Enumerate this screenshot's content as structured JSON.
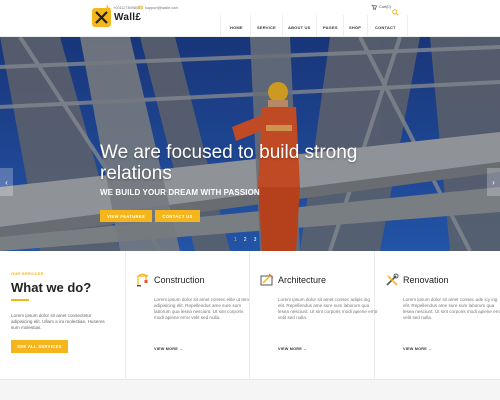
{
  "header": {
    "logo_text": "Wall£",
    "phone": "+0011278098081",
    "email": "support@walle.com",
    "cart": "Cart(0)",
    "nav": [
      "HOME",
      "SERVICE",
      "ABOUT US",
      "PAGES",
      "SHOP",
      "CONTACT"
    ]
  },
  "hero": {
    "title": "We are focused to build strong relations",
    "subtitle": "WE BUILD YOUR DREAM WITH PASSION",
    "primary_button": "VIEW FEATURES",
    "secondary_button": "CONTACT US",
    "slides": [
      "1",
      "2",
      "3"
    ],
    "active_slide": 1,
    "prev_arrow": "‹",
    "next_arrow": "›"
  },
  "services_intro": {
    "label": "OUR SERVICES",
    "title": "What we do?",
    "text": "Lorem ipsum dolor sit amet consectetur adipisicing elit. Ullam a ira molestiae, Huseres sum molestias.",
    "button": "SEE ALL SERVICES"
  },
  "services": [
    {
      "icon": "crane-icon",
      "title": "Construction",
      "text": "Lorem ipsum dolor sit amet consec elite ut tem adipisicing elit. Repellendus ame sure sum laborum qua lesea nesciunt. Ut sint corporis modi apiene error velit sed nulla.",
      "link": "VIEW MORE"
    },
    {
      "icon": "blueprint-icon",
      "title": "Architecture",
      "text": "Lorem ipsum dolor sit amet consec adipis ing elit. Repellendus ame sure sum laborum qua lesea nesciunt. Ut sint corporis modi apiene error velit sed nulla.",
      "link": "VIEW MORE"
    },
    {
      "icon": "tools-icon",
      "title": "Renovation",
      "text": "Lorem ipsum dolor sit amet consec ade icy ing elit. Repellendus ame sure sum laborum qua lesea nesciunt. Ut sint corporis modi apiene error velit sed nulla.",
      "link": "VIEW MORE"
    }
  ],
  "colors": {
    "accent": "#f5b51d",
    "hero_sky": "#1f4fa8",
    "text_dark": "#222222"
  }
}
